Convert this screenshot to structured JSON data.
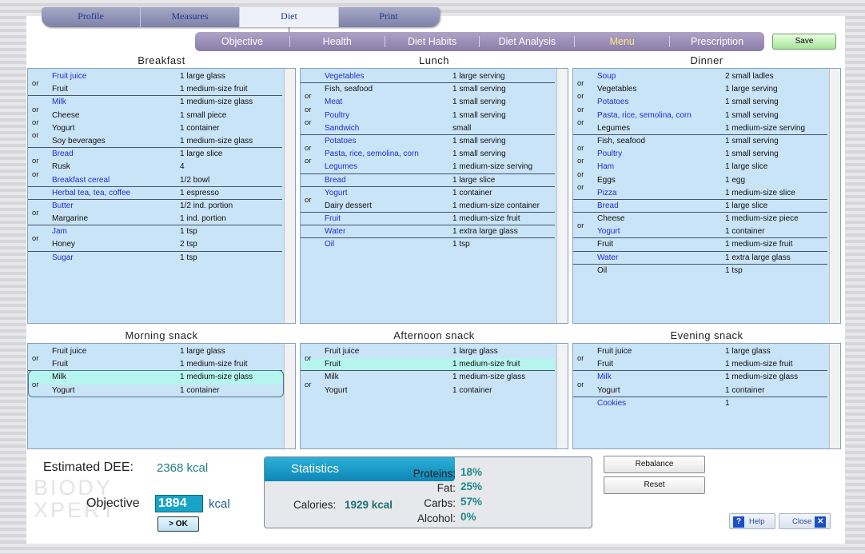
{
  "top_tabs": [
    {
      "label": "Profile"
    },
    {
      "label": "Measures"
    },
    {
      "label": "Diet"
    },
    {
      "label": "Print"
    }
  ],
  "sub_tabs": [
    {
      "label": "Objective"
    },
    {
      "label": "Health"
    },
    {
      "label": "Diet Habits"
    },
    {
      "label": "Diet Analysis"
    },
    {
      "label": "Menu"
    },
    {
      "label": "Prescription"
    }
  ],
  "save_label": "Save",
  "meals": {
    "breakfast": {
      "title": "Breakfast",
      "rows": [
        {
          "food": "Fruit juice",
          "qty": "1 large glass",
          "or": "",
          "color": "blue",
          "sep": false
        },
        {
          "food": "Fruit",
          "qty": "1 medium-size fruit",
          "or": "or",
          "color": "black",
          "sep": true
        },
        {
          "food": "Milk",
          "qty": "1 medium-size glass",
          "or": "",
          "color": "blue",
          "sep": false
        },
        {
          "food": "Cheese",
          "qty": "1 small piece",
          "or": "or",
          "color": "black",
          "sep": false
        },
        {
          "food": "Yogurt",
          "qty": "1 container",
          "or": "or",
          "color": "black",
          "sep": false
        },
        {
          "food": "Soy beverages",
          "qty": "1 medium-size glass",
          "or": "or",
          "color": "black",
          "sep": true
        },
        {
          "food": "Bread",
          "qty": "1 large slice",
          "or": "",
          "color": "blue",
          "sep": false
        },
        {
          "food": "Rusk",
          "qty": "4",
          "or": "or",
          "color": "black",
          "sep": false
        },
        {
          "food": "Breakfast cereal",
          "qty": "1/2 bowl",
          "or": "or",
          "color": "blue",
          "sep": true
        },
        {
          "food": "Herbal tea, tea, coffee",
          "qty": "1 espresso",
          "or": "",
          "color": "blue",
          "sep": true
        },
        {
          "food": "Butter",
          "qty": "1/2 ind. portion",
          "or": "",
          "color": "blue",
          "sep": false
        },
        {
          "food": "Margarine",
          "qty": "1 ind. portion",
          "or": "or",
          "color": "black",
          "sep": true
        },
        {
          "food": "Jam",
          "qty": "1 tsp",
          "or": "",
          "color": "blue",
          "sep": false
        },
        {
          "food": "Honey",
          "qty": "2 tsp",
          "or": "or",
          "color": "black",
          "sep": true
        },
        {
          "food": "Sugar",
          "qty": "1 tsp",
          "or": "",
          "color": "blue",
          "sep": false
        }
      ]
    },
    "lunch": {
      "title": "Lunch",
      "rows": [
        {
          "food": "Vegetables",
          "qty": "1 large serving",
          "or": "",
          "color": "blue",
          "sep": true
        },
        {
          "food": "Fish, seafood",
          "qty": "1 small serving",
          "or": "",
          "color": "black",
          "sep": false
        },
        {
          "food": "Meat",
          "qty": "1 small serving",
          "or": "or",
          "color": "blue",
          "sep": false
        },
        {
          "food": "Poultry",
          "qty": "1 small serving",
          "or": "or",
          "color": "blue",
          "sep": false
        },
        {
          "food": "Sandwich",
          "qty": "small",
          "or": "or",
          "color": "blue",
          "sep": true
        },
        {
          "food": "Potatoes",
          "qty": "1 small serving",
          "or": "",
          "color": "blue",
          "sep": false
        },
        {
          "food": "Pasta, rice, semolina, corn",
          "qty": "1 small serving",
          "or": "or",
          "color": "blue",
          "sep": false
        },
        {
          "food": "Legumes",
          "qty": "1 medium-size serving",
          "or": "or",
          "color": "blue",
          "sep": true
        },
        {
          "food": "Bread",
          "qty": "1 large slice",
          "or": "",
          "color": "blue",
          "sep": true
        },
        {
          "food": "Yogurt",
          "qty": "1 container",
          "or": "",
          "color": "blue",
          "sep": false
        },
        {
          "food": "Dairy dessert",
          "qty": "1 medium-size container",
          "or": "or",
          "color": "black",
          "sep": true
        },
        {
          "food": "Fruit",
          "qty": "1 medium-size fruit",
          "or": "",
          "color": "blue",
          "sep": true
        },
        {
          "food": "Water",
          "qty": "1 extra large glass",
          "or": "",
          "color": "blue",
          "sep": true
        },
        {
          "food": "Oil",
          "qty": "1 tsp",
          "or": "",
          "color": "blue",
          "sep": false
        }
      ]
    },
    "dinner": {
      "title": "Dinner",
      "rows": [
        {
          "food": "Soup",
          "qty": "2 small ladles",
          "or": "",
          "color": "blue",
          "sep": false
        },
        {
          "food": "Vegetables",
          "qty": "1 large serving",
          "or": "or",
          "color": "black",
          "sep": false
        },
        {
          "food": "Potatoes",
          "qty": "1 small serving",
          "or": "or",
          "color": "blue",
          "sep": false
        },
        {
          "food": "Pasta, rice, semolina, corn",
          "qty": "1 small serving",
          "or": "or",
          "color": "blue",
          "sep": false
        },
        {
          "food": "Legumes",
          "qty": "1 medium-size serving",
          "or": "or",
          "color": "black",
          "sep": true
        },
        {
          "food": "Fish, seafood",
          "qty": "1 small serving",
          "or": "",
          "color": "black",
          "sep": false
        },
        {
          "food": "Poultry",
          "qty": "1 small serving",
          "or": "or",
          "color": "blue",
          "sep": false
        },
        {
          "food": "Ham",
          "qty": "1 large slice",
          "or": "or",
          "color": "blue",
          "sep": false
        },
        {
          "food": "Eggs",
          "qty": "1 egg",
          "or": "or",
          "color": "black",
          "sep": false
        },
        {
          "food": "Pizza",
          "qty": "1 medium-size slice",
          "or": "or",
          "color": "blue",
          "sep": true
        },
        {
          "food": "Bread",
          "qty": "1 large slice",
          "or": "",
          "color": "blue",
          "sep": true
        },
        {
          "food": "Cheese",
          "qty": "1 medium-size piece",
          "or": "",
          "color": "black",
          "sep": false
        },
        {
          "food": "Yogurt",
          "qty": "1 container",
          "or": "or",
          "color": "blue",
          "sep": true
        },
        {
          "food": "Fruit",
          "qty": "1 medium-size fruit",
          "or": "",
          "color": "black",
          "sep": true
        },
        {
          "food": "Water",
          "qty": "1 extra large glass",
          "or": "",
          "color": "blue",
          "sep": true
        },
        {
          "food": "Oil",
          "qty": "1 tsp",
          "or": "",
          "color": "black",
          "sep": false
        }
      ]
    },
    "morning_snack": {
      "title": "Morning snack",
      "rows": [
        {
          "food": "Fruit juice",
          "qty": "1 large glass",
          "or": "",
          "color": "black",
          "sep": false
        },
        {
          "food": "Fruit",
          "qty": "1 medium-size fruit",
          "or": "or",
          "color": "black",
          "sep": true
        },
        {
          "food": "Milk",
          "qty": "1 medium-size glass",
          "or": "",
          "color": "black",
          "sep": false,
          "hl": true
        },
        {
          "food": "Yogurt",
          "qty": "1 container",
          "or": "or",
          "color": "black",
          "sep": false
        }
      ]
    },
    "afternoon_snack": {
      "title": "Afternoon snack",
      "rows": [
        {
          "food": "Fruit juice",
          "qty": "1 large glass",
          "or": "",
          "color": "black",
          "sep": false
        },
        {
          "food": "Fruit",
          "qty": "1 medium-size fruit",
          "or": "or",
          "color": "black",
          "sep": true,
          "hl": true
        },
        {
          "food": "Milk",
          "qty": "1 medium-size glass",
          "or": "",
          "color": "black",
          "sep": false
        },
        {
          "food": "Yogurt",
          "qty": "1 container",
          "or": "or",
          "color": "black",
          "sep": false
        }
      ]
    },
    "evening_snack": {
      "title": "Evening snack",
      "rows": [
        {
          "food": "Fruit juice",
          "qty": "1 large glass",
          "or": "",
          "color": "black",
          "sep": false
        },
        {
          "food": "Fruit",
          "qty": "1 medium-size fruit",
          "or": "or",
          "color": "black",
          "sep": true
        },
        {
          "food": "Milk",
          "qty": "1 medium-size glass",
          "or": "",
          "color": "blue",
          "sep": false
        },
        {
          "food": "Yogurt",
          "qty": "1 container",
          "or": "or",
          "color": "black",
          "sep": true
        },
        {
          "food": "Cookies",
          "qty": "1",
          "or": "",
          "color": "blue",
          "sep": false
        }
      ]
    }
  },
  "estimated_dee": {
    "label": "Estimated DEE:",
    "value": "2368 kcal"
  },
  "watermark": {
    "line1": "BIODY",
    "line2": "XPERT"
  },
  "objective": {
    "label": "Objective",
    "value": "1894",
    "unit": "kcal",
    "ok_label": "> OK"
  },
  "statistics": {
    "title": "Statistics",
    "calories_label": "Calories:",
    "calories_value": "1929 kcal",
    "macros": [
      {
        "label": "Proteins:",
        "value": "18%"
      },
      {
        "label": "Fat:",
        "value": "25%"
      },
      {
        "label": "Carbs:",
        "value": "57%"
      },
      {
        "label": "Alcohol:",
        "value": "0%"
      }
    ]
  },
  "buttons": {
    "rebalance": "Rebalance",
    "reset": "Reset",
    "help": "Help",
    "close": "Close"
  }
}
